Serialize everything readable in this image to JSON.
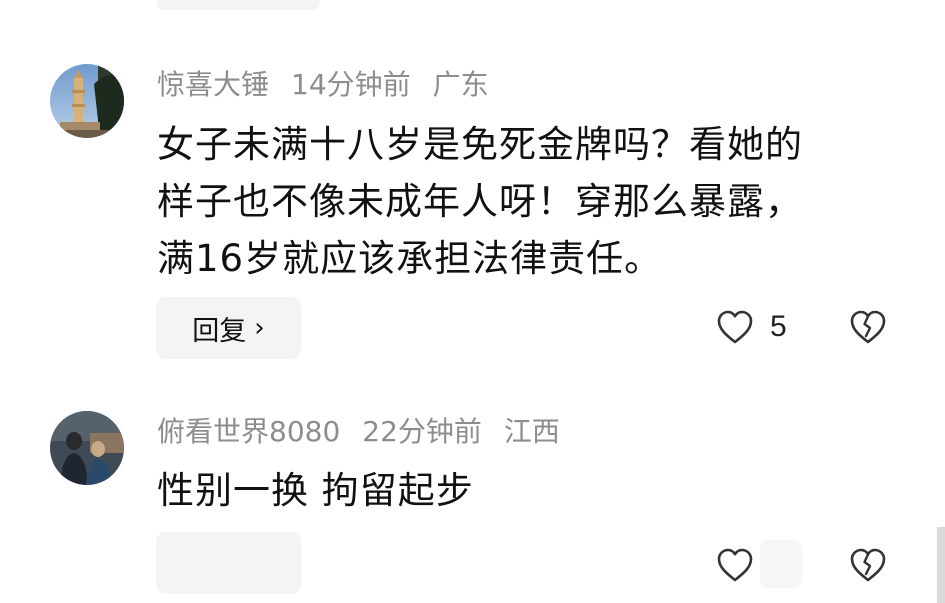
{
  "comments": [
    {
      "username": "惊喜大锤",
      "time": "14分钟前",
      "location": "广东",
      "text_lines": [
        "女子未满十八岁是免死金牌吗？看她的",
        "样子也不像未成年人呀！穿那么暴露，",
        "满16岁就应该承担法律责任。"
      ],
      "reply_label": "回复",
      "like_count": "5",
      "avatar": "tower-photo"
    },
    {
      "username": "俯看世界8080",
      "time": "22分钟前",
      "location": "江西",
      "text_lines": [
        "性别一换 拘留起步"
      ],
      "like_count": "",
      "avatar": "people-photo"
    }
  ],
  "icons": {
    "chevron": "›",
    "like": "heart-outline-icon",
    "dislike": "broken-heart-icon"
  }
}
